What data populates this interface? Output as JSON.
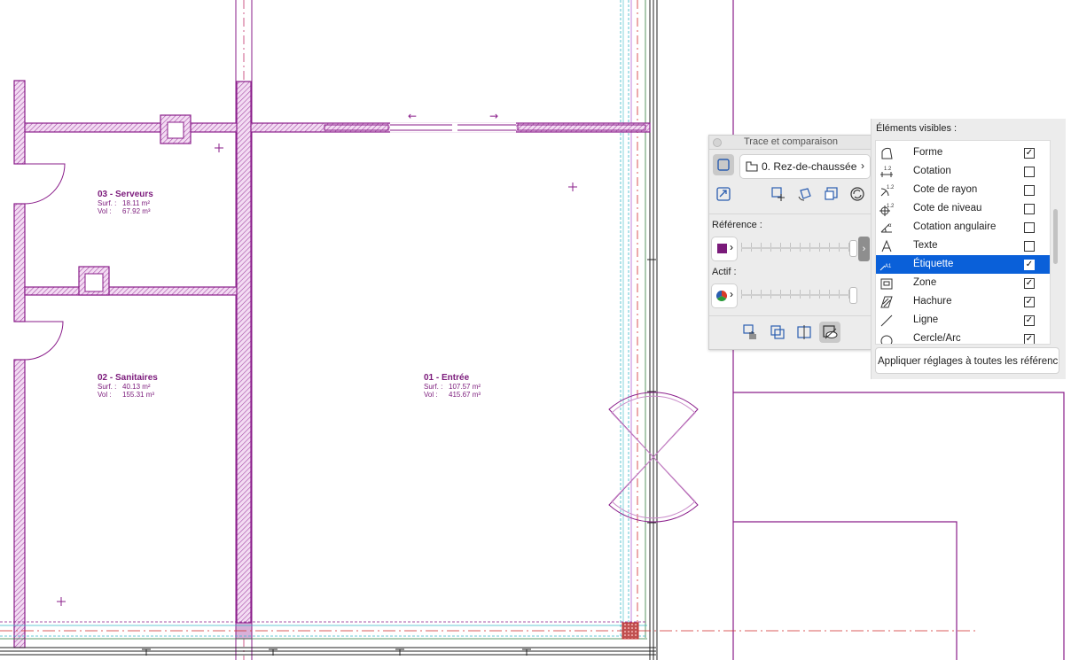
{
  "rooms": [
    {
      "number": "03",
      "name": "Serveurs",
      "surf_label": "Surf. :",
      "surf": "18.11 m²",
      "vol_label": "Vol :",
      "vol": "67.92 m³"
    },
    {
      "number": "02",
      "name": "Sanitaires",
      "surf_label": "Surf. :",
      "surf": "40.13 m²",
      "vol_label": "Vol :",
      "vol": "155.31 m³"
    },
    {
      "number": "01",
      "name": "Entrée",
      "surf_label": "Surf. :",
      "surf": "107.57 m²",
      "vol_label": "Vol :",
      "vol": "415.67 m³"
    }
  ],
  "colors": {
    "plan": "#8a1d8a",
    "hatch": "#c98bc9",
    "accent": "#0a60d9"
  },
  "trace_panel": {
    "title": "Trace et comparaison",
    "layer_value": "0. Rez-de-chaussée",
    "reference_label": "Référence :",
    "active_label": "Actif :",
    "reference_color": "#7a1a7a",
    "reference_level": 0.95,
    "active_level": 0.95,
    "icons": [
      "trace-toggle-icon",
      "story-icon",
      "switch-reference-icon",
      "move-reference-icon",
      "rotate-reference-icon",
      "reset-reference-icon",
      "refresh-icon",
      "hand-icon",
      "compare-icon",
      "split-icon",
      "visibility-icon"
    ]
  },
  "visible_panel": {
    "title": "Éléments visibles :",
    "items": [
      {
        "label": "Forme",
        "checked": true,
        "icon": "shape-icon"
      },
      {
        "label": "Cotation",
        "checked": false,
        "icon": "dimension-icon"
      },
      {
        "label": "Cote de rayon",
        "checked": false,
        "icon": "radius-dimension-icon"
      },
      {
        "label": "Cote de niveau",
        "checked": false,
        "icon": "level-dimension-icon"
      },
      {
        "label": "Cotation angulaire",
        "checked": false,
        "icon": "angle-dimension-icon"
      },
      {
        "label": "Texte",
        "checked": false,
        "icon": "text-icon"
      },
      {
        "label": "Étiquette",
        "checked": true,
        "icon": "label-icon",
        "selected": true
      },
      {
        "label": "Zone",
        "checked": true,
        "icon": "zone-icon"
      },
      {
        "label": "Hachure",
        "checked": true,
        "icon": "fill-icon"
      },
      {
        "label": "Ligne",
        "checked": true,
        "icon": "line-icon"
      },
      {
        "label": "Cercle/Arc",
        "checked": true,
        "icon": "circle-arc-icon"
      }
    ],
    "apply_button": "Appliquer réglages à toutes les référenc"
  }
}
